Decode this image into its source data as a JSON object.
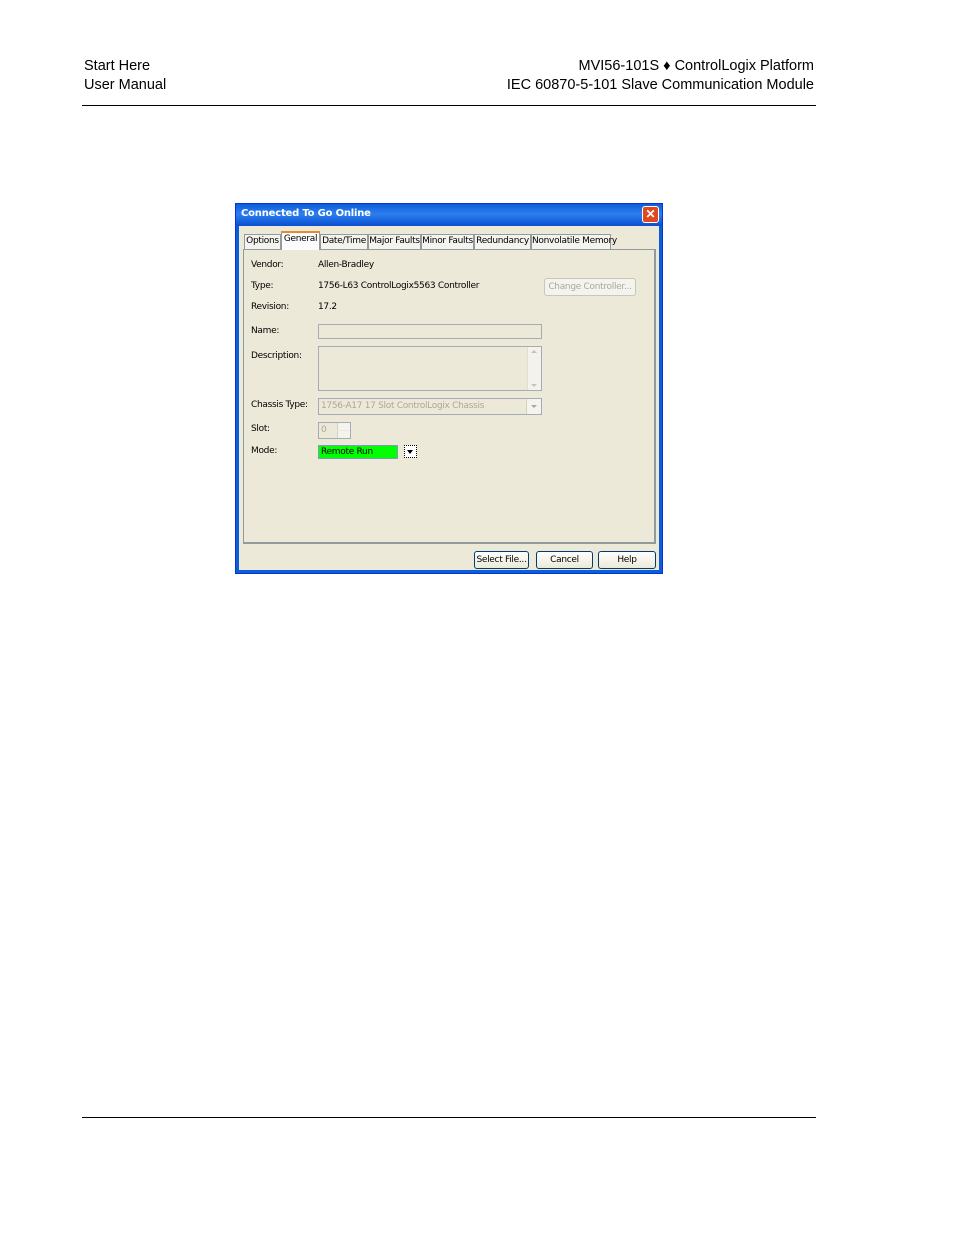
{
  "header": {
    "left_line1": "Start Here",
    "left_line2": "User Manual",
    "right_line1": "MVI56-101S ♦ ControlLogix Platform",
    "right_line2": "IEC 60870-5-101 Slave Communication Module"
  },
  "dialog": {
    "title": "Connected To Go Online",
    "close_glyph": "✕",
    "tabs": [
      {
        "label": "Options"
      },
      {
        "label": "General"
      },
      {
        "label": "Date/Time"
      },
      {
        "label": "Major Faults"
      },
      {
        "label": "Minor Faults"
      },
      {
        "label": "Redundancy"
      },
      {
        "label": "Nonvolatile Memory"
      }
    ],
    "active_tab": "General",
    "fields": {
      "vendor_label": "Vendor:",
      "vendor_value": "Allen-Bradley",
      "type_label": "Type:",
      "type_value": "1756-L63 ControlLogix5563 Controller",
      "revision_label": "Revision:",
      "revision_value": "17.2",
      "name_label": "Name:",
      "name_value": "",
      "description_label": "Description:",
      "description_value": "",
      "chassis_label": "Chassis Type:",
      "chassis_value": "1756-A17   17 Slot ControlLogix Chassis",
      "slot_label": "Slot:",
      "slot_value": "0",
      "mode_label": "Mode:",
      "mode_value": "Remote Run"
    },
    "change_controller_label": "Change Controller...",
    "buttons": {
      "select_file": "Select File...",
      "cancel": "Cancel",
      "help": "Help"
    },
    "colors": {
      "mode_bg": "#00ff00",
      "titlebar": "#0a5fd8",
      "face": "#ece9d8"
    }
  }
}
